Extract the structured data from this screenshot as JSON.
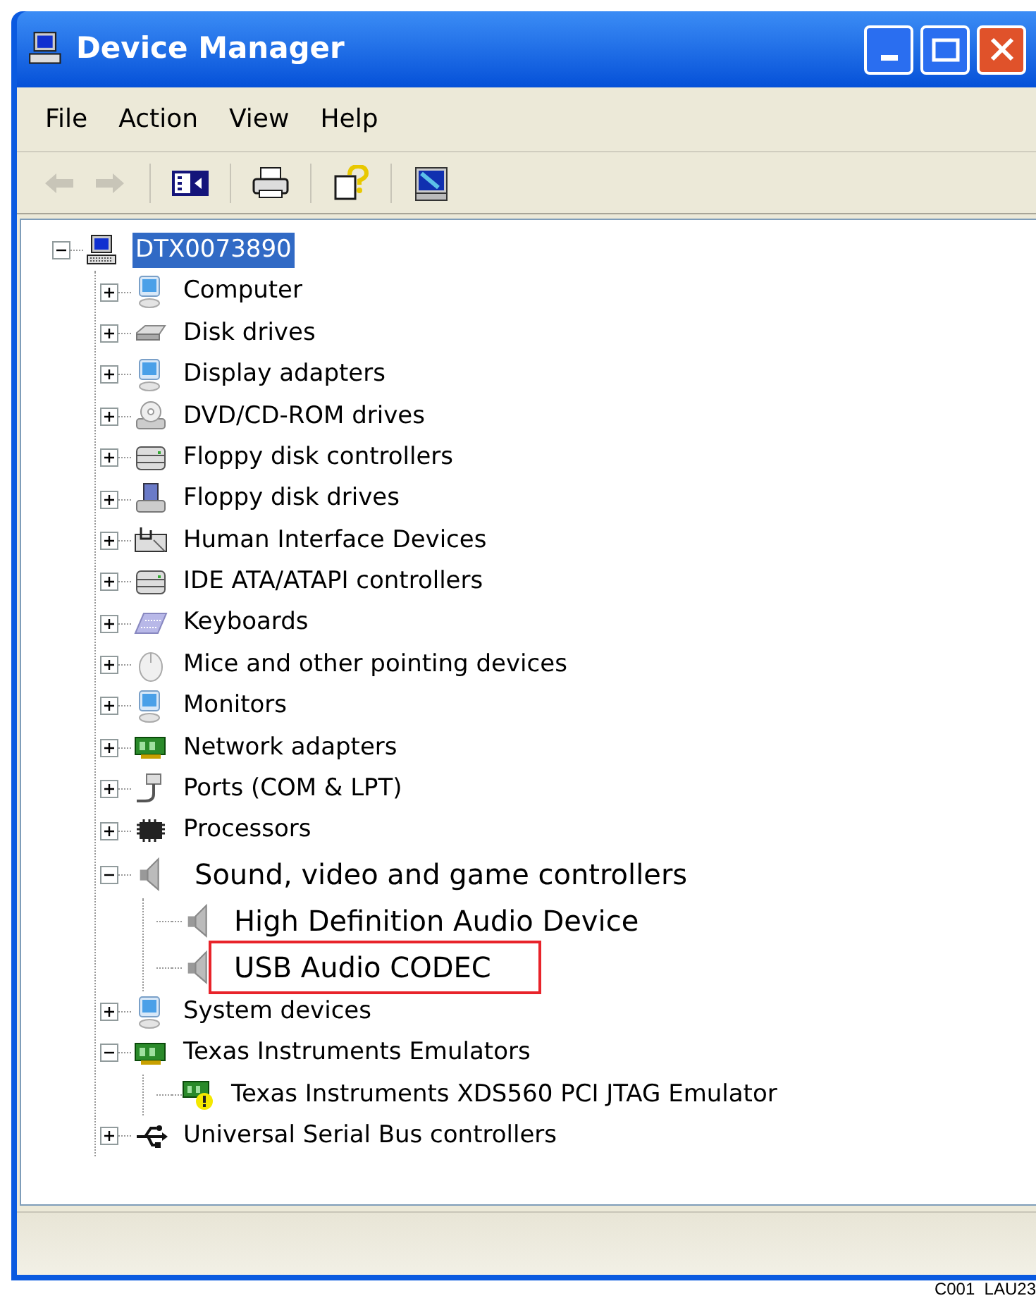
{
  "window": {
    "title": "Device Manager"
  },
  "menu": [
    "File",
    "Action",
    "View",
    "Help"
  ],
  "toolbar": [
    {
      "kind": "back",
      "disabled": true
    },
    {
      "kind": "forward",
      "disabled": true
    },
    {
      "kind": "separator"
    },
    {
      "kind": "console-tree"
    },
    {
      "kind": "separator"
    },
    {
      "kind": "print"
    },
    {
      "kind": "separator"
    },
    {
      "kind": "help"
    },
    {
      "kind": "separator"
    },
    {
      "kind": "properties"
    }
  ],
  "tree": [
    {
      "label": "DTX0073890",
      "kind": "computer",
      "selected": true,
      "expanded": true,
      "children": [
        {
          "label": "Computer",
          "kind": "monitor",
          "selected": false,
          "expanded": false
        },
        {
          "label": "Disk drives",
          "kind": "disk",
          "selected": false,
          "expanded": false
        },
        {
          "label": "Display adapters",
          "kind": "monitor",
          "selected": false,
          "expanded": false
        },
        {
          "label": "DVD/CD-ROM drives",
          "kind": "dvd",
          "selected": false,
          "expanded": false
        },
        {
          "label": "Floppy disk controllers",
          "kind": "controller",
          "selected": false,
          "expanded": false
        },
        {
          "label": "Floppy disk drives",
          "kind": "floppy",
          "selected": false,
          "expanded": false
        },
        {
          "label": "Human Interface Devices",
          "kind": "hid",
          "selected": false,
          "expanded": false
        },
        {
          "label": "IDE ATA/ATAPI controllers",
          "kind": "controller",
          "selected": false,
          "expanded": false
        },
        {
          "label": "Keyboards",
          "kind": "keyboard",
          "selected": false,
          "expanded": false
        },
        {
          "label": "Mice and other pointing devices",
          "kind": "mouse",
          "selected": false,
          "expanded": false
        },
        {
          "label": "Monitors",
          "kind": "monitor",
          "selected": false,
          "expanded": false
        },
        {
          "label": "Network adapters",
          "kind": "board",
          "selected": false,
          "expanded": false
        },
        {
          "label": "Ports (COM & LPT)",
          "kind": "port",
          "selected": false,
          "expanded": false
        },
        {
          "label": "Processors",
          "kind": "chip",
          "selected": false,
          "expanded": false
        },
        {
          "label": "Sound, video and game controllers",
          "kind": "speaker",
          "selected": false,
          "expanded": true,
          "enlarged": true,
          "children": [
            {
              "label": "High Definition Audio Device",
              "kind": "speaker",
              "selected": false,
              "enlarged": true,
              "highlighted": false
            },
            {
              "label": "USB Audio CODEC",
              "kind": "speaker",
              "selected": false,
              "enlarged": true,
              "highlighted": true
            }
          ]
        },
        {
          "label": "System devices",
          "kind": "monitor",
          "selected": false,
          "expanded": false
        },
        {
          "label": "Texas Instruments Emulators",
          "kind": "board",
          "selected": false,
          "expanded": true,
          "children": [
            {
              "label": "Texas Instruments XDS560 PCI JTAG Emulator",
              "kind": "board-warning",
              "selected": false
            }
          ]
        },
        {
          "label": "Universal Serial Bus controllers",
          "kind": "usb",
          "selected": false,
          "expanded": false
        }
      ]
    }
  ],
  "figure_label": "C001  LAU23"
}
